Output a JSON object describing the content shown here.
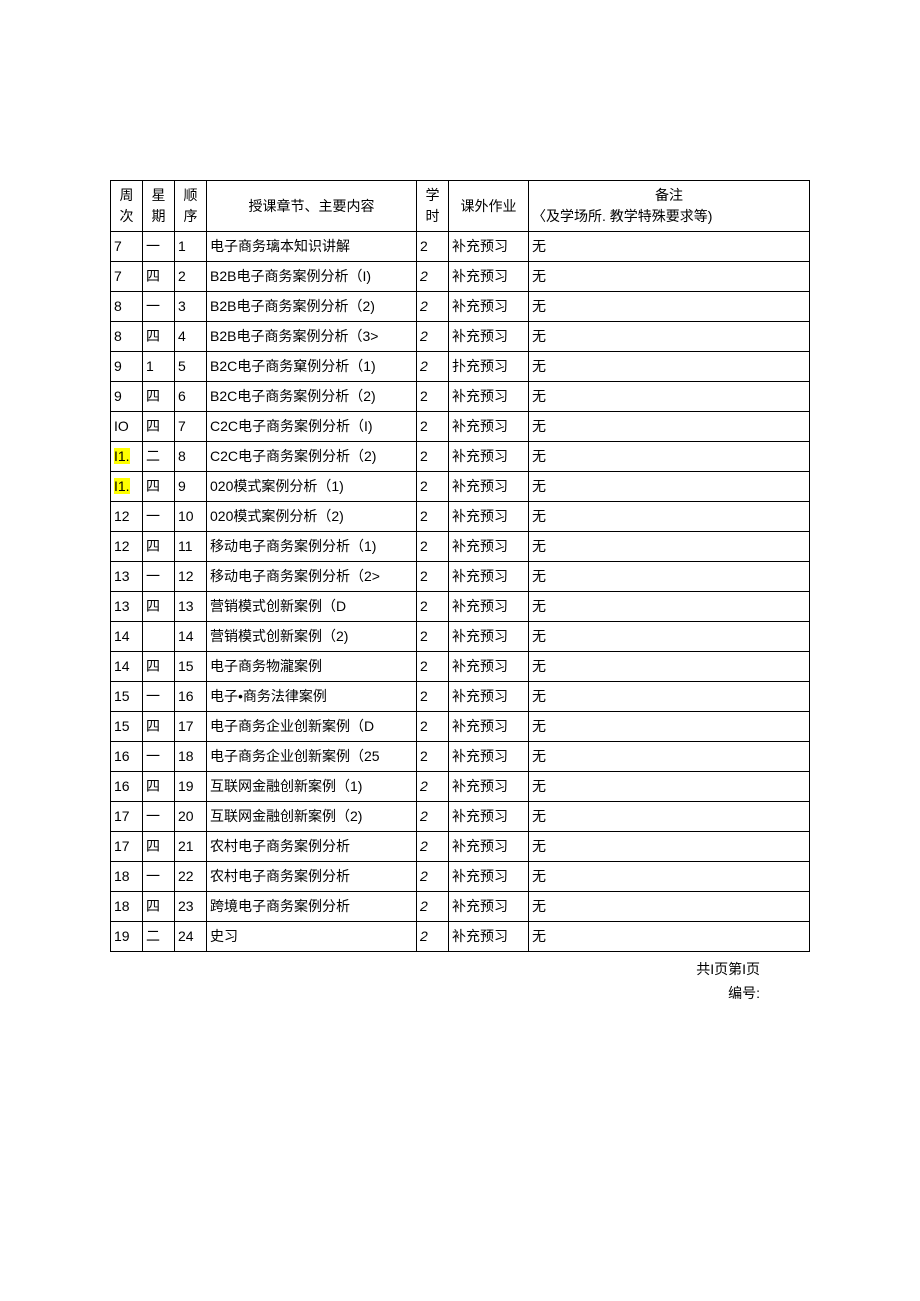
{
  "headers": {
    "week": "周次",
    "day": "星期",
    "order": "顺序",
    "content": "授课章节、主要内容",
    "hours": "学时",
    "homework": "课外作业",
    "note_line1": "备注",
    "note_line2": "〈及学场所. 教学特殊要求等)"
  },
  "rows": [
    {
      "week": "7",
      "day": "一",
      "order": "1",
      "content": "电子商务璃本知识讲解",
      "hours": "2",
      "hw": "补充预习",
      "note": "无"
    },
    {
      "week": "7",
      "day": "四",
      "order": "2",
      "content": "B2B电子商务案例分析（I)",
      "hours": "2",
      "hours_italic": true,
      "hw": "补充预习",
      "note": "无"
    },
    {
      "week": "8",
      "day": "一",
      "order": "3",
      "content": "B2B电子商务案例分析（2)",
      "hours": "2",
      "hours_italic": true,
      "hw": "补充预习",
      "note": "无"
    },
    {
      "week": "8",
      "day": "四",
      "order": "4",
      "content": "B2B电子商务案例分析（3>",
      "hours": "2",
      "hours_italic": true,
      "hw": "补充预习",
      "note": "无"
    },
    {
      "week": "9",
      "day": "1",
      "order": "5",
      "content": "B2C电子商务窠例分析（1)",
      "hours": "2",
      "hours_italic": true,
      "hw": "扑充预习",
      "note": "无"
    },
    {
      "week": "9",
      "day": "四",
      "order": "6",
      "content": "B2C电子商务案例分析（2)",
      "hours": "2",
      "hw": "补充预习",
      "note": "无"
    },
    {
      "week": "IO",
      "day": "四",
      "order": "7",
      "content": "C2C电子商务案例分析（I)",
      "hours": "2",
      "hw": "补充预习",
      "note": "无"
    },
    {
      "week": "I1.",
      "week_hl": true,
      "day": "二",
      "order": "8",
      "content": "C2C电子商务案例分析（2)",
      "hours": "2",
      "hw": "补充预习",
      "note": "无"
    },
    {
      "week": "I1.",
      "week_hl": true,
      "day": "四",
      "order": "9",
      "content": "020模式案例分析（1)",
      "hours": "2",
      "hw": "补充预习",
      "note": "无"
    },
    {
      "week": "12",
      "day": "一",
      "order": "10",
      "content": "020模式案例分析（2)",
      "hours": "2",
      "hw": "补充预习",
      "note": "无"
    },
    {
      "week": "12",
      "day": "四",
      "order": "11",
      "content": "移动电子商务案例分析（1)",
      "hours": "2",
      "hw": "补充预习",
      "note": "无"
    },
    {
      "week": "13",
      "day": "一",
      "order": "12",
      "content": "移动电子商务案例分析（2>",
      "hours": "2",
      "hw": "补充预习",
      "note": "无"
    },
    {
      "week": "13",
      "day": "四",
      "order": "13",
      "content": "营销模式创新案例（D",
      "hours": "2",
      "hw": "补充预习",
      "note": "无"
    },
    {
      "week": "14",
      "day": "",
      "order": "14",
      "content": "营销模式创新案例（2)",
      "hours": "2",
      "hw": "补充预习",
      "note": "无"
    },
    {
      "week": "14",
      "day": "四",
      "order": "15",
      "content": "电子商务物瀧案例",
      "hours": "2",
      "hw": "补充预习",
      "note": "无"
    },
    {
      "week": "15",
      "day": "一",
      "order": "16",
      "content": "电子•商务法律案例",
      "hours": "2",
      "hw": "补充预习",
      "note": "无"
    },
    {
      "week": "15",
      "day": "四",
      "order": "17",
      "content": "电子商务企业创新案例（D",
      "hours": "2",
      "hw": "补充预习",
      "note": "无"
    },
    {
      "week": "16",
      "day": "一",
      "order": "18",
      "content": "电子商务企业创新案例（25",
      "hours": "2",
      "hw": "补充预习",
      "note": "无"
    },
    {
      "week": "16",
      "day": "四",
      "order": "19",
      "content": "互联网金融创新案例（1)",
      "hours": "2",
      "hours_italic": true,
      "hw": "补充预习",
      "note": "无"
    },
    {
      "week": "17",
      "day": "一",
      "order": "20",
      "content": "互联网金融创新案例（2)",
      "hours": "2",
      "hours_italic": true,
      "hw": "补充预习",
      "note": "无"
    },
    {
      "week": "17",
      "day": "四",
      "order": "21",
      "content": "农村电子商务案例分析",
      "hours": "2",
      "hours_italic": true,
      "hw": "补充预习",
      "note": "无"
    },
    {
      "week": "18",
      "day": "一",
      "order": "22",
      "content": "农村电子商务案例分析",
      "hours": "2",
      "hours_italic": true,
      "hw": "补充预习",
      "note": "无"
    },
    {
      "week": "18",
      "day": "四",
      "order": "23",
      "content": "跨境电子商务案例分析",
      "hours": "2",
      "hours_italic": true,
      "hw": "补充预习",
      "note": "无"
    },
    {
      "week": "19",
      "day": "二",
      "order": "24",
      "content": "史习",
      "hours": "2",
      "hours_italic": true,
      "hw": "补充预习",
      "note": "无"
    }
  ],
  "footer": {
    "pageinfo": "共I页第I页",
    "serial": "编号:"
  }
}
